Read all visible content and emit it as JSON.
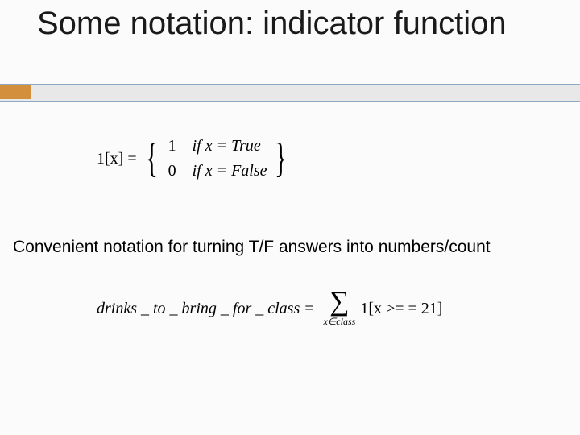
{
  "title": "Some notation: indicator function",
  "eq1": {
    "lhs": "1[x] =",
    "cases": [
      {
        "value": "1",
        "cond": "if x = True"
      },
      {
        "value": "0",
        "cond": "if x = False"
      }
    ]
  },
  "body": "Convenient notation for turning T/F answers into numbers/count",
  "eq2": {
    "lhs": "drinks _ to _ bring _ for _ class",
    "eq": "=",
    "sigma_sub": "x∈class",
    "rhs": "1[x >= = 21]"
  }
}
